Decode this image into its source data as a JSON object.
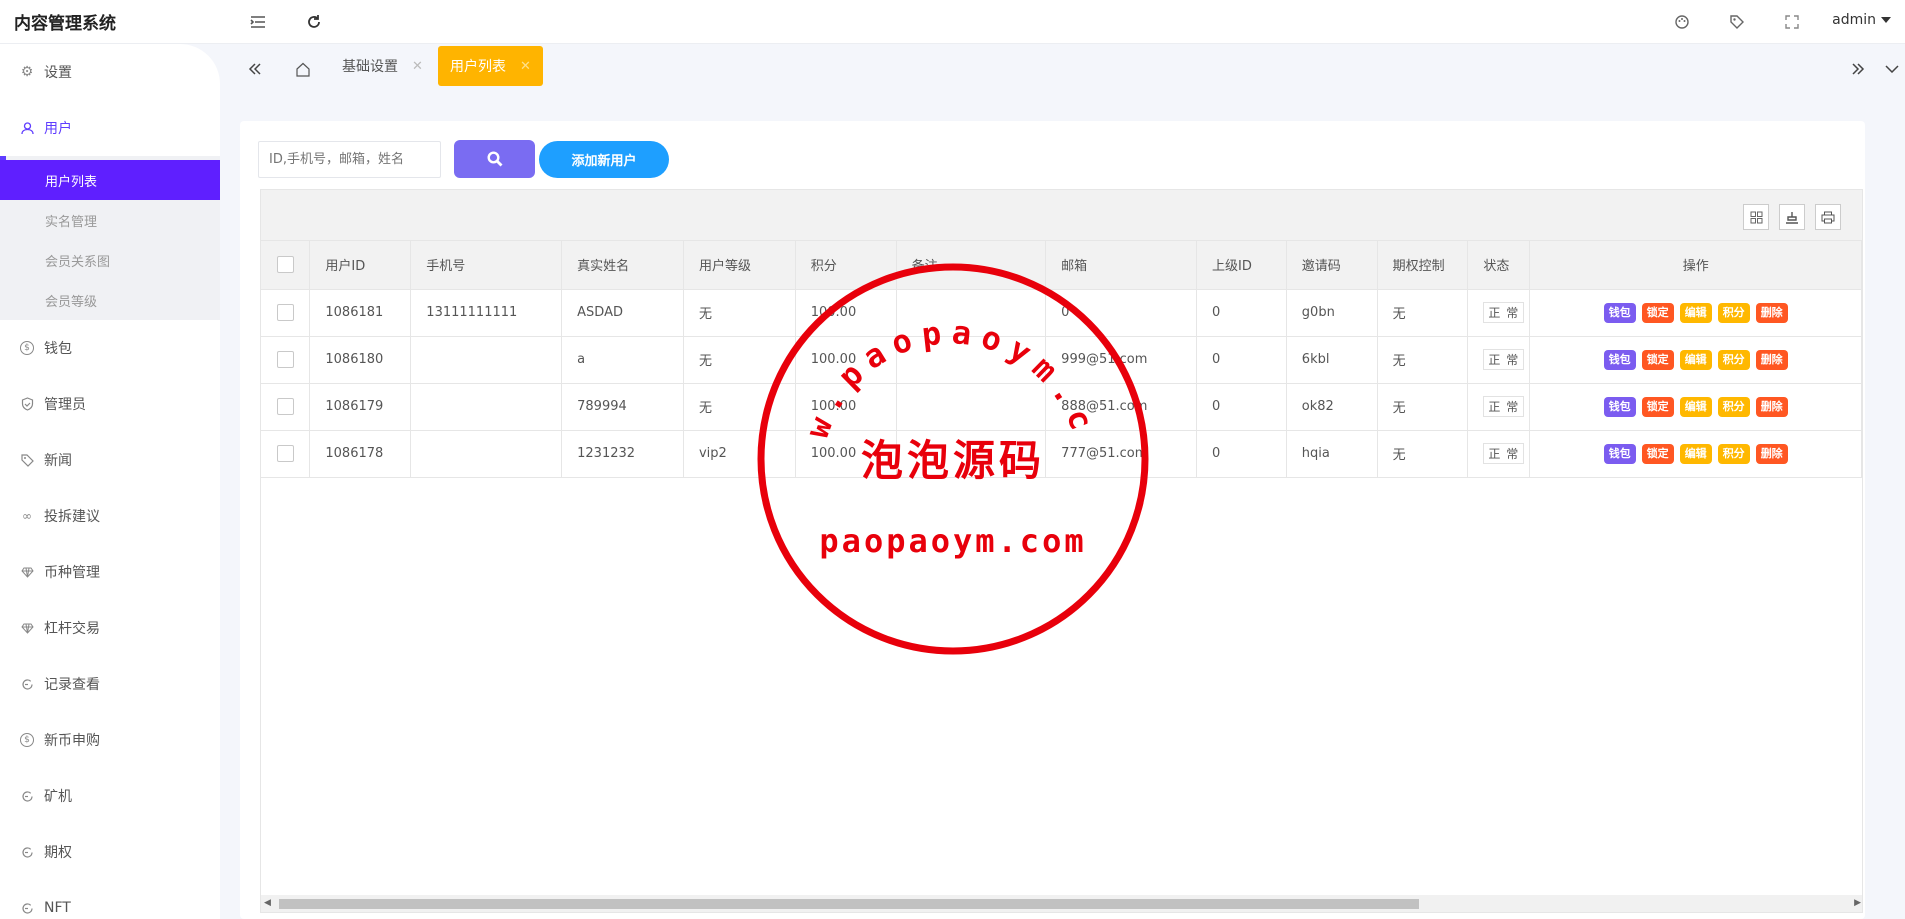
{
  "app": {
    "title": "内容管理系统",
    "user": "admin"
  },
  "sidebar": {
    "items": [
      {
        "label": "设置",
        "icon": "gear-icon"
      },
      {
        "label": "用户",
        "icon": "user-icon",
        "active": true,
        "children": [
          {
            "label": "用户列表",
            "active": true
          },
          {
            "label": "实名管理"
          },
          {
            "label": "会员关系图"
          },
          {
            "label": "会员等级"
          }
        ]
      },
      {
        "label": "钱包",
        "icon": "dollar-icon"
      },
      {
        "label": "管理员",
        "icon": "shield-icon"
      },
      {
        "label": "新闻",
        "icon": "tag-icon"
      },
      {
        "label": "投拆建议",
        "icon": "link-icon"
      },
      {
        "label": "币种管理",
        "icon": "diamond-icon"
      },
      {
        "label": "杠杆交易",
        "icon": "diamond-icon"
      },
      {
        "label": "记录查看",
        "icon": "record-icon"
      },
      {
        "label": "新币申购",
        "icon": "dollar-icon"
      },
      {
        "label": "矿机",
        "icon": "record-icon"
      },
      {
        "label": "期权",
        "icon": "record-icon"
      },
      {
        "label": "NFT",
        "icon": "record-icon"
      }
    ]
  },
  "tabs": [
    {
      "label": "基础设置"
    },
    {
      "label": "用户列表",
      "active": true
    }
  ],
  "search": {
    "placeholder": "ID,手机号，邮箱，姓名",
    "add_label": "添加新用户"
  },
  "table": {
    "columns": [
      "用户ID",
      "手机号",
      "真实姓名",
      "用户等级",
      "积分",
      "备注",
      "邮箱",
      "上级ID",
      "邀请码",
      "期权控制",
      "状态",
      "操作"
    ],
    "rows": [
      {
        "id": "1086181",
        "phone": "13111111111",
        "name": "ASDAD",
        "level": "无",
        "points": "100.00",
        "note": "",
        "email": "0",
        "parent": "0",
        "invite": "g0bn",
        "option_ctrl": "无",
        "status": "正 常"
      },
      {
        "id": "1086180",
        "phone": "",
        "name": "a",
        "level": "无",
        "points": "100.00",
        "note": "",
        "email": "999@51.com",
        "parent": "0",
        "invite": "6kbl",
        "option_ctrl": "无",
        "status": "正 常"
      },
      {
        "id": "1086179",
        "phone": "",
        "name": "789994",
        "level": "无",
        "points": "100.00",
        "note": "",
        "email": "888@51.com",
        "parent": "0",
        "invite": "ok82",
        "option_ctrl": "无",
        "status": "正 常"
      },
      {
        "id": "1086178",
        "phone": "",
        "name": "1231232",
        "level": "vip2",
        "points": "100.00",
        "note": "",
        "email": "777@51.com",
        "parent": "0",
        "invite": "hqia",
        "option_ctrl": "无",
        "status": "正 常"
      }
    ],
    "actions": [
      {
        "label": "钱包",
        "color": "#7b5cf0"
      },
      {
        "label": "锁定",
        "color": "#ff5722"
      },
      {
        "label": "编辑",
        "color": "#ffb800"
      },
      {
        "label": "积分",
        "color": "#ffb800"
      },
      {
        "label": "删除",
        "color": "#ff5722"
      }
    ]
  },
  "watermark": {
    "arc_text": "www.paopaoym.com",
    "center_text": "泡泡源码",
    "bottom_text": "paopaoym.com",
    "color": "#e8000b"
  },
  "colors": {
    "accent": "#5f1fff",
    "tab_active": "#ffb400",
    "search_btn": "#7a6cf2",
    "add_btn": "#1e9fff"
  }
}
